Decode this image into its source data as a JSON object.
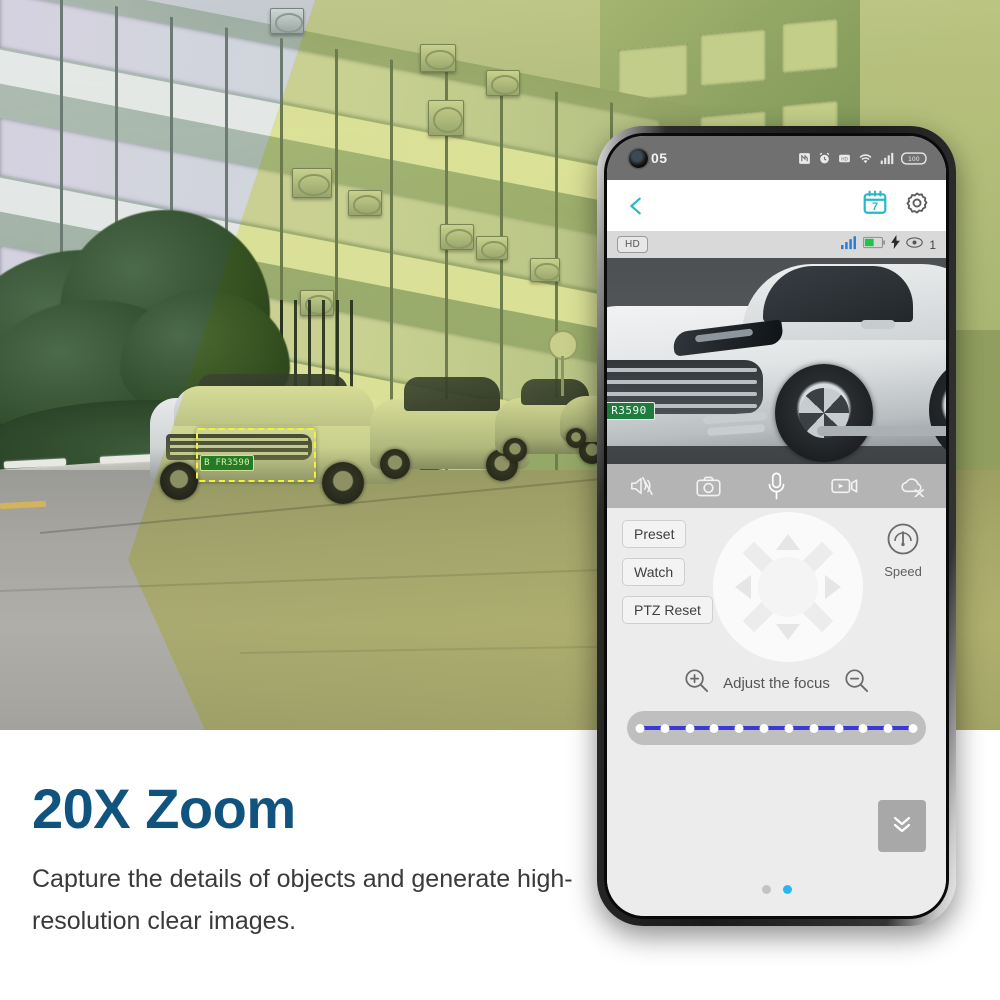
{
  "caption": {
    "title": "20X Zoom",
    "subtitle": "Capture the details of objects and generate high-resolution clear images.",
    "title_color": "#10537f"
  },
  "scene": {
    "license_plate": "B FR3590",
    "highlight_color": "#e8ef4a",
    "selection_box_color": "#f2f432"
  },
  "phone": {
    "statusbar": {
      "clock": "05",
      "icons": [
        "nfc-icon",
        "alarm-icon",
        "hd-audio-icon",
        "wifi-icon",
        "signal-icon",
        "battery-icon"
      ],
      "battery_level": "100"
    },
    "navbar": {
      "back": "back-chevron-icon",
      "calendar_day": "7",
      "icons": [
        "calendar-icon",
        "settings-gear-icon"
      ]
    },
    "video_header": {
      "quality": "HD",
      "viewer_count": "1",
      "icons": [
        "signal-bars-icon",
        "battery-icon",
        "bolt-icon",
        "eye-icon"
      ]
    },
    "video": {
      "license_plate": "R3590"
    },
    "mediabar": {
      "items": [
        {
          "name": "mute-icon",
          "label": "Mute"
        },
        {
          "name": "snapshot-icon",
          "label": "Snapshot"
        },
        {
          "name": "microphone-icon",
          "label": "Talk"
        },
        {
          "name": "record-icon",
          "label": "Record"
        },
        {
          "name": "cloud-off-icon",
          "label": "Cloud"
        }
      ]
    },
    "ptz": {
      "buttons": [
        {
          "label": "Preset"
        },
        {
          "label": "Watch"
        },
        {
          "label": "PTZ Reset"
        }
      ],
      "speed_label": "Speed",
      "focus_label": "Adjust the focus",
      "focus_in": "zoom-in-icon",
      "focus_out": "zoom-out-icon",
      "slider": {
        "ticks": 12,
        "track_color": "#3b38d6",
        "value": 100
      },
      "collapse": "chevron-double-down-icon"
    },
    "pager": {
      "pages": 2,
      "active": 2,
      "active_color": "#29b6f0"
    }
  }
}
